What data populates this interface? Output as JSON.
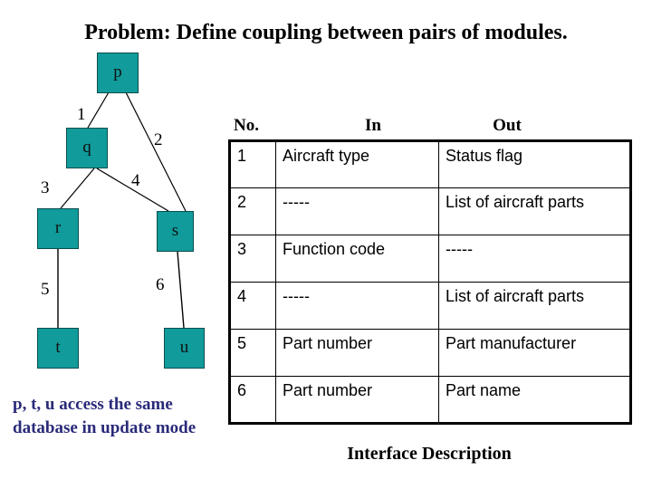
{
  "slide": {
    "title": "Problem: Define coupling between pairs of modules.",
    "background_color": "#FFFFFF"
  },
  "structure_chart": {
    "node_fill_color": "#119B9B",
    "node_border_color": "#0B4D4D",
    "nodes": [
      {
        "id": "p",
        "label": "p"
      },
      {
        "id": "q",
        "label": "q"
      },
      {
        "id": "r",
        "label": "r"
      },
      {
        "id": "s",
        "label": "s"
      },
      {
        "id": "t",
        "label": "t"
      },
      {
        "id": "u",
        "label": "u"
      }
    ],
    "edges": [
      {
        "number": "1",
        "from": "p",
        "to": "q"
      },
      {
        "number": "2",
        "from": "p",
        "to": "s"
      },
      {
        "number": "3",
        "from": "q",
        "to": "r"
      },
      {
        "number": "4",
        "from": "q",
        "to": "s"
      },
      {
        "number": "5",
        "from": "r",
        "to": "t"
      },
      {
        "number": "6",
        "from": "s",
        "to": "u"
      }
    ],
    "note": "p, t, u access the same database in update mode",
    "note_color": "#2A2A7A"
  },
  "interface_table": {
    "headers": [
      "No.",
      "In",
      "Out"
    ],
    "rows": [
      {
        "no": "1",
        "in": "Aircraft type",
        "out": "Status flag"
      },
      {
        "no": "2",
        "in": "-----",
        "out": "List of aircraft parts"
      },
      {
        "no": "3",
        "in": "Function code",
        "out": "-----"
      },
      {
        "no": "4",
        "in": "-----",
        "out": "List of aircraft parts"
      },
      {
        "no": "5",
        "in": "Part number",
        "out": "Part manufacturer"
      },
      {
        "no": "6",
        "in": "Part number",
        "out": "Part name"
      }
    ],
    "caption": "Interface Description"
  }
}
